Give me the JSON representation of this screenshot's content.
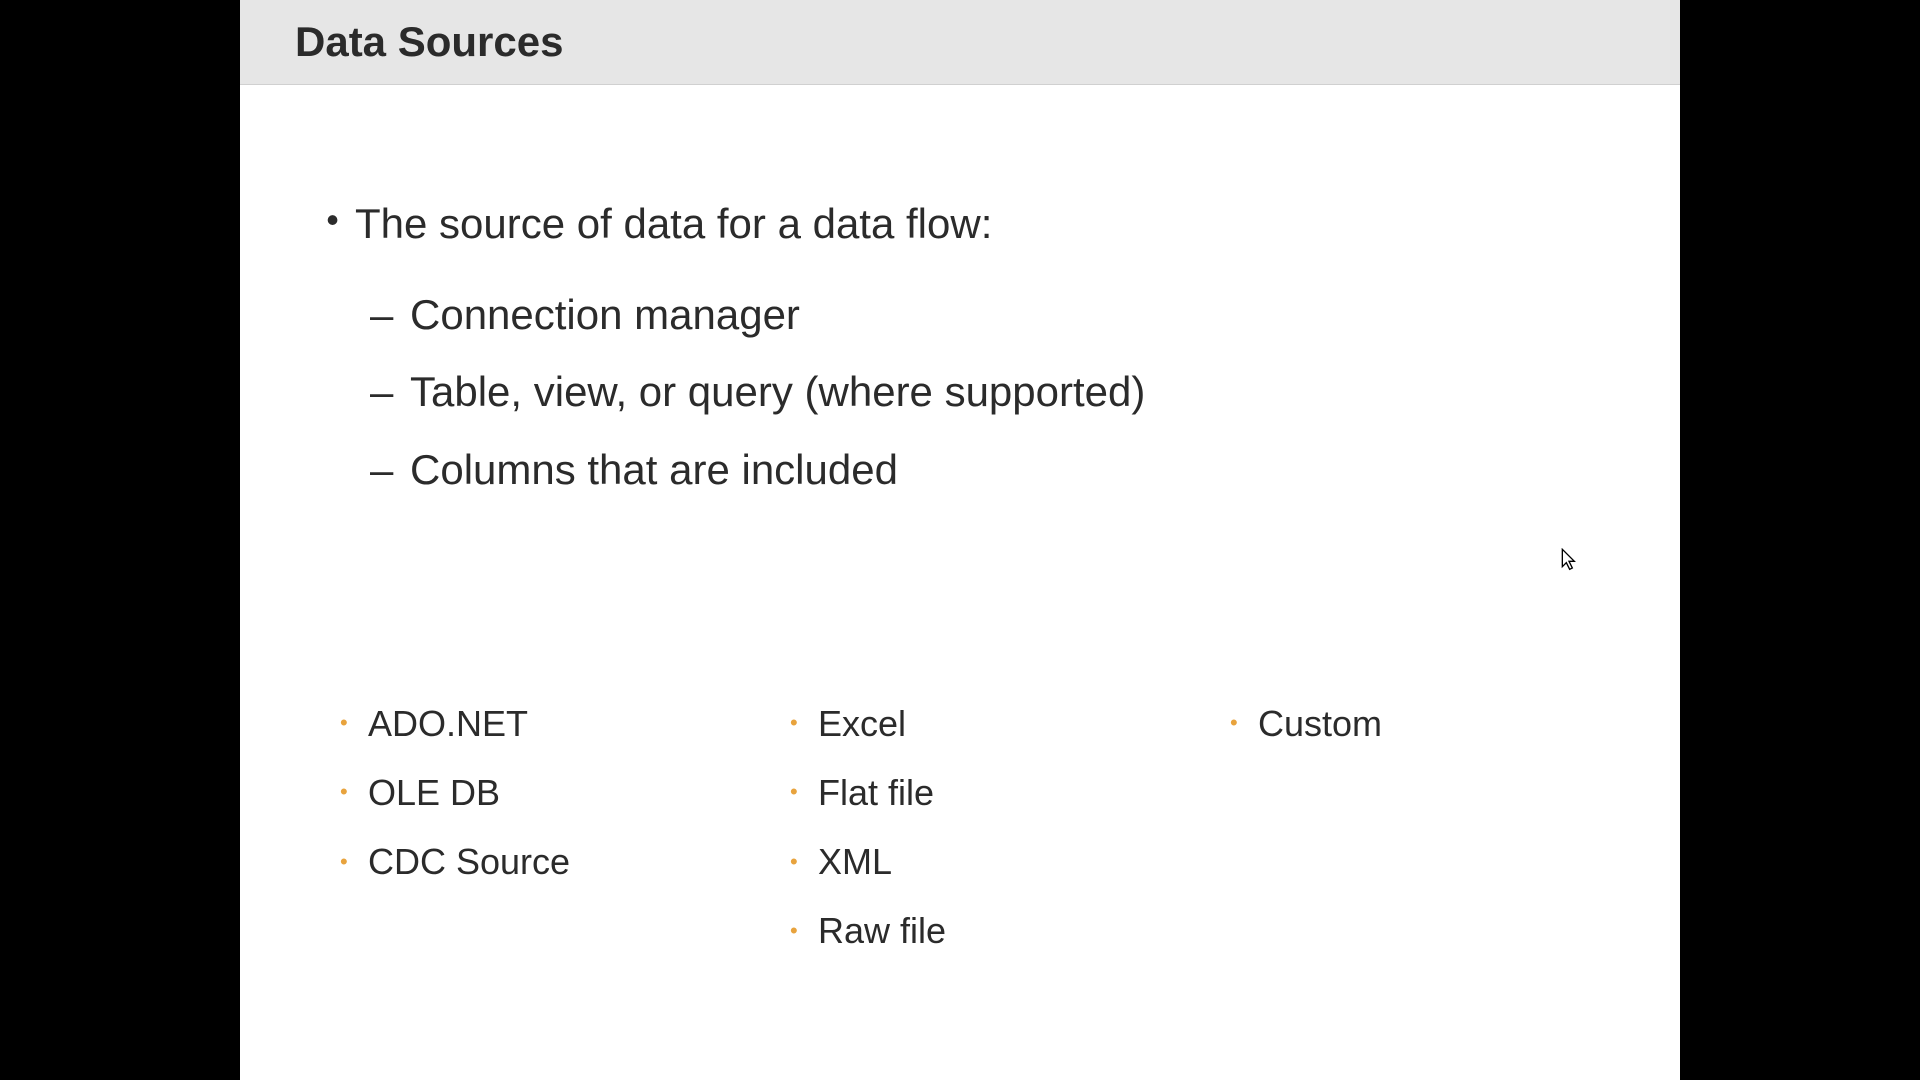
{
  "slide": {
    "title": "Data Sources",
    "main_bullet": "The source of data for a data flow:",
    "sub_items": [
      "Connection manager",
      "Table, view, or query (where supported)",
      "Columns that are included"
    ],
    "columns": {
      "col1": [
        "ADO.NET",
        "OLE DB",
        "CDC Source"
      ],
      "col2": [
        "Excel",
        "Flat file",
        "XML",
        "Raw file"
      ],
      "col3": [
        "Custom"
      ]
    }
  }
}
